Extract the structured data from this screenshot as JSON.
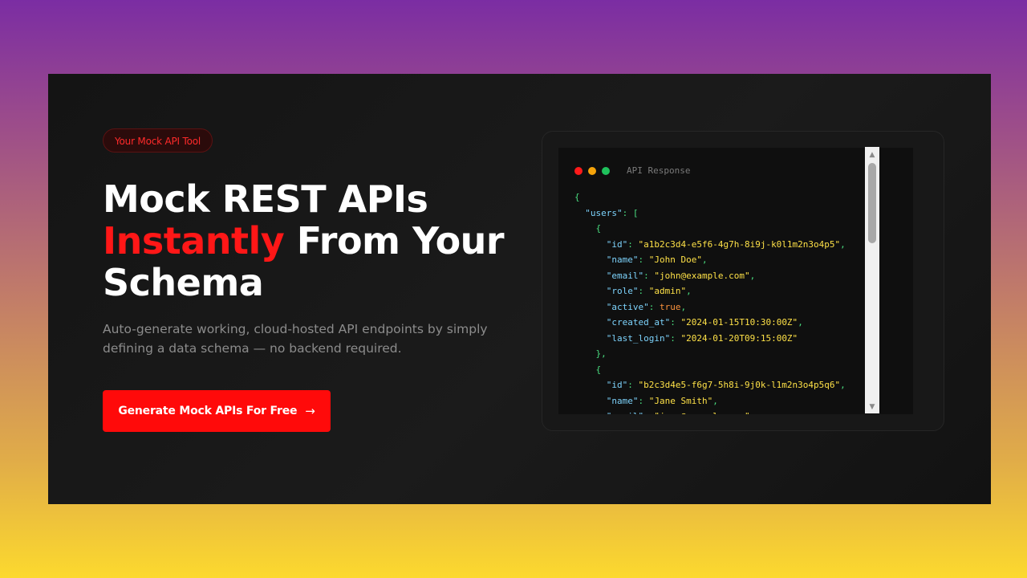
{
  "hero": {
    "badge": "Your Mock API Tool",
    "title_line1": "Mock REST APIs",
    "title_accent": "Instantly",
    "title_rest": "From Your Schema",
    "subtitle": "Auto-generate working, cloud-hosted API endpoints by simply defining a data schema — no backend required.",
    "cta_label": "Generate Mock APIs For Free",
    "cta_icon": "arrow-right-icon"
  },
  "code_window": {
    "title": "API Response",
    "dots": [
      "red",
      "yellow",
      "green"
    ],
    "lines": [
      [
        {
          "t": "{",
          "c": "p"
        }
      ],
      [
        {
          "t": "  ",
          "c": "p"
        },
        {
          "t": "\"users\"",
          "c": "k"
        },
        {
          "t": ": [",
          "c": "p"
        }
      ],
      [
        {
          "t": "    {",
          "c": "p"
        }
      ],
      [
        {
          "t": "      ",
          "c": "p"
        },
        {
          "t": "\"id\"",
          "c": "k"
        },
        {
          "t": ": ",
          "c": "p"
        },
        {
          "t": "\"a1b2c3d4-e5f6-4g7h-8i9j-k0l1m2n3o4p5\"",
          "c": "s"
        },
        {
          "t": ",",
          "c": "p"
        }
      ],
      [
        {
          "t": "      ",
          "c": "p"
        },
        {
          "t": "\"name\"",
          "c": "k"
        },
        {
          "t": ": ",
          "c": "p"
        },
        {
          "t": "\"John Doe\"",
          "c": "s"
        },
        {
          "t": ",",
          "c": "p"
        }
      ],
      [
        {
          "t": "      ",
          "c": "p"
        },
        {
          "t": "\"email\"",
          "c": "k"
        },
        {
          "t": ": ",
          "c": "p"
        },
        {
          "t": "\"john@example.com\"",
          "c": "s"
        },
        {
          "t": ",",
          "c": "p"
        }
      ],
      [
        {
          "t": "      ",
          "c": "p"
        },
        {
          "t": "\"role\"",
          "c": "k"
        },
        {
          "t": ": ",
          "c": "p"
        },
        {
          "t": "\"admin\"",
          "c": "s"
        },
        {
          "t": ",",
          "c": "p"
        }
      ],
      [
        {
          "t": "      ",
          "c": "p"
        },
        {
          "t": "\"active\"",
          "c": "k"
        },
        {
          "t": ": ",
          "c": "p"
        },
        {
          "t": "true",
          "c": "b"
        },
        {
          "t": ",",
          "c": "p"
        }
      ],
      [
        {
          "t": "      ",
          "c": "p"
        },
        {
          "t": "\"created_at\"",
          "c": "k"
        },
        {
          "t": ": ",
          "c": "p"
        },
        {
          "t": "\"2024-01-15T10:30:00Z\"",
          "c": "s"
        },
        {
          "t": ",",
          "c": "p"
        }
      ],
      [
        {
          "t": "      ",
          "c": "p"
        },
        {
          "t": "\"last_login\"",
          "c": "k"
        },
        {
          "t": ": ",
          "c": "p"
        },
        {
          "t": "\"2024-01-20T09:15:00Z\"",
          "c": "s"
        }
      ],
      [
        {
          "t": "    },",
          "c": "p"
        }
      ],
      [
        {
          "t": "    {",
          "c": "p"
        }
      ],
      [
        {
          "t": "      ",
          "c": "p"
        },
        {
          "t": "\"id\"",
          "c": "k"
        },
        {
          "t": ": ",
          "c": "p"
        },
        {
          "t": "\"b2c3d4e5-f6g7-5h8i-9j0k-l1m2n3o4p5q6\"",
          "c": "s"
        },
        {
          "t": ",",
          "c": "p"
        }
      ],
      [
        {
          "t": "      ",
          "c": "p"
        },
        {
          "t": "\"name\"",
          "c": "k"
        },
        {
          "t": ": ",
          "c": "p"
        },
        {
          "t": "\"Jane Smith\"",
          "c": "s"
        },
        {
          "t": ",",
          "c": "p"
        }
      ],
      [
        {
          "t": "      ",
          "c": "p"
        },
        {
          "t": "\"email\"",
          "c": "k"
        },
        {
          "t": ": ",
          "c": "p"
        },
        {
          "t": "\"jane@example.com\"",
          "c": "s"
        },
        {
          "t": ",",
          "c": "p"
        }
      ]
    ]
  },
  "scrollbar": {
    "up_icon": "▲",
    "down_icon": "▼"
  }
}
